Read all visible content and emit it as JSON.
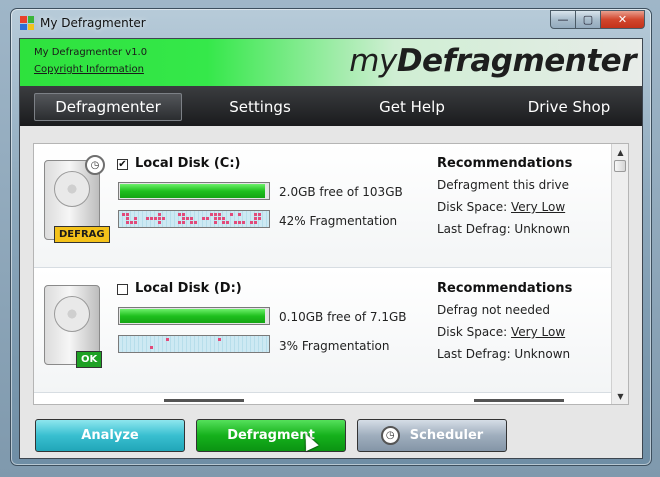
{
  "window": {
    "title": "My Defragmenter",
    "controls": {
      "minimize": "—",
      "maximize": "▢",
      "close": "✕"
    }
  },
  "banner": {
    "version": "My Defragmenter v1.0",
    "copyright_link": "Copyright Information",
    "brand_part1": "my",
    "brand_part2": "Defragmenter"
  },
  "nav": {
    "tabs": [
      {
        "label": "Defragmenter",
        "active": true
      },
      {
        "label": "Settings",
        "active": false
      },
      {
        "label": "Get Help",
        "active": false
      },
      {
        "label": "Drive Shop",
        "active": false
      }
    ]
  },
  "drives": [
    {
      "name": "Local Disk (C:)",
      "checked": true,
      "checkbox_glyph": "✔",
      "badge": "DEFRAG",
      "space_text": "2.0GB free of 103GB",
      "space_used_fraction": 0.98,
      "fragmentation_text": "42% Fragmentation",
      "fragmentation_percent": 42,
      "rec_title": "Recommendations",
      "rec_action": "Defragment this drive",
      "disk_space_label": "Disk Space: ",
      "disk_space_value": "Very Low",
      "last_defrag": "Last Defrag: Unknown"
    },
    {
      "name": "Local Disk (D:)",
      "checked": false,
      "checkbox_glyph": "",
      "badge": "OK",
      "space_text": "0.10GB free of 7.1GB",
      "space_used_fraction": 0.98,
      "fragmentation_text": "3% Fragmentation",
      "fragmentation_percent": 3,
      "rec_title": "Recommendations",
      "rec_action": "Defrag not needed",
      "disk_space_label": "Disk Space: ",
      "disk_space_value": "Very Low",
      "last_defrag": "Last Defrag: Unknown"
    }
  ],
  "scrollbar": {
    "up": "▲",
    "down": "▼"
  },
  "buttons": {
    "analyze": "Analyze",
    "defragment": "Defragment",
    "scheduler": "Scheduler"
  },
  "colors": {
    "banner_green": "#2ee23d",
    "defrag_badge": "#f4c21a",
    "ok_badge": "#1ea124",
    "space_bar": "#1fc01e",
    "frag_dot": "#e24a7a"
  }
}
